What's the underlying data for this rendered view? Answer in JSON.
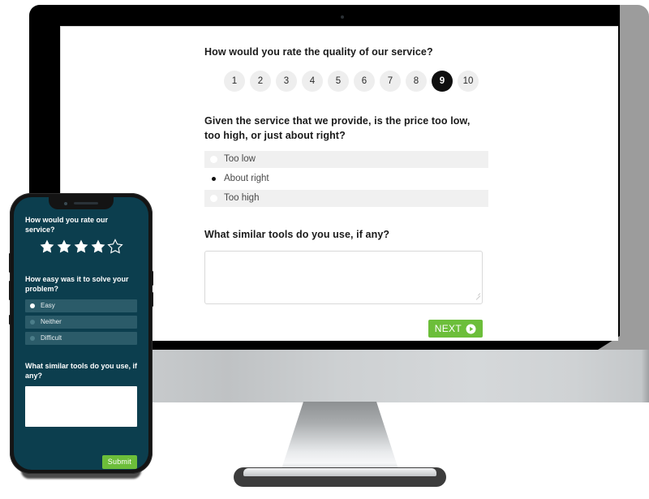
{
  "desktop": {
    "question1": {
      "text": "How would you rate the quality of our service?",
      "scale": [
        "1",
        "2",
        "3",
        "4",
        "5",
        "6",
        "7",
        "8",
        "9",
        "10"
      ],
      "selected": "9"
    },
    "question2": {
      "text": "Given the service that we provide, is the price too low, too high, or just about right?",
      "options": [
        "Too low",
        "About right",
        "Too high"
      ],
      "selected": "About right"
    },
    "question3": {
      "text": "What similar tools do you use, if any?",
      "value": "",
      "placeholder": ""
    },
    "next_button": {
      "label": "NEXT",
      "icon": "play-circle-icon",
      "color": "#6cbe3a"
    }
  },
  "phone": {
    "question1": {
      "text": "How would you rate our service?",
      "stars_total": 5,
      "stars_filled": 4
    },
    "question2": {
      "text": "How easy was it to solve your problem?",
      "options": [
        "Easy",
        "Neither",
        "Difficult"
      ],
      "selected": "Easy"
    },
    "question3": {
      "text": "What similar tools do you use, if any?",
      "value": "",
      "placeholder": ""
    },
    "submit_button": {
      "label": "Submit",
      "color": "#6cbe3a"
    },
    "theme": {
      "background": "#0c3e4e",
      "option_background": "#2b5b69"
    }
  }
}
